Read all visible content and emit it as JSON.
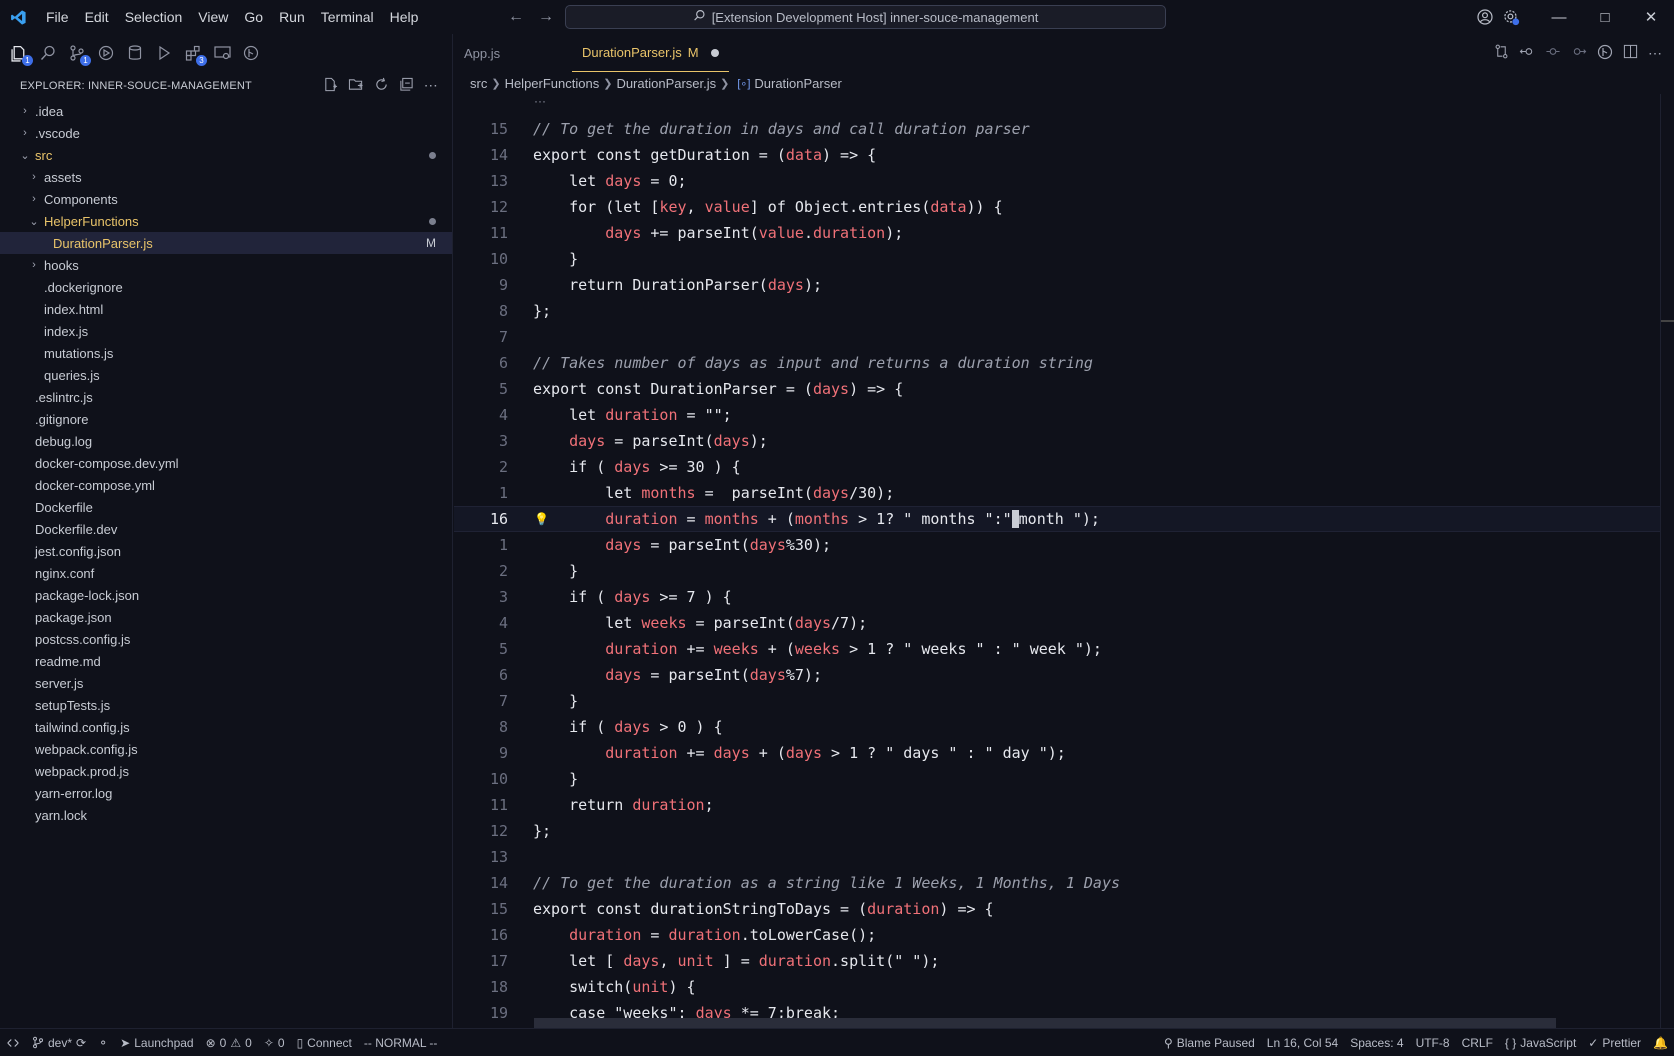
{
  "menu": [
    "File",
    "Edit",
    "Selection",
    "View",
    "Go",
    "Run",
    "Terminal",
    "Help"
  ],
  "command_center": "[Extension Development Host] inner-souce-management",
  "sidebar": {
    "title": "EXPLORER: INNER-SOUCE-MANAGEMENT",
    "badge_explorer": "1",
    "badge_scm": "1",
    "badge_ext": "3",
    "tree": [
      {
        "label": ".idea",
        "depth": 0,
        "chev": "›"
      },
      {
        "label": ".vscode",
        "depth": 0,
        "chev": "›"
      },
      {
        "label": "src",
        "depth": 0,
        "chev": "⌄",
        "dot": true,
        "kind": "src"
      },
      {
        "label": "assets",
        "depth": 1,
        "chev": "›"
      },
      {
        "label": "Components",
        "depth": 1,
        "chev": "›"
      },
      {
        "label": "HelperFunctions",
        "depth": 1,
        "chev": "⌄",
        "dot": true,
        "kind": "open"
      },
      {
        "label": "DurationParser.js",
        "depth": 2,
        "chev": "",
        "mark": "M",
        "kind": "selected"
      },
      {
        "label": "hooks",
        "depth": 1,
        "chev": "›"
      },
      {
        "label": ".dockerignore",
        "depth": 1,
        "chev": ""
      },
      {
        "label": "index.html",
        "depth": 1,
        "chev": ""
      },
      {
        "label": "index.js",
        "depth": 1,
        "chev": ""
      },
      {
        "label": "mutations.js",
        "depth": 1,
        "chev": ""
      },
      {
        "label": "queries.js",
        "depth": 1,
        "chev": ""
      },
      {
        "label": ".eslintrc.js",
        "depth": 0,
        "chev": ""
      },
      {
        "label": ".gitignore",
        "depth": 0,
        "chev": ""
      },
      {
        "label": "debug.log",
        "depth": 0,
        "chev": ""
      },
      {
        "label": "docker-compose.dev.yml",
        "depth": 0,
        "chev": ""
      },
      {
        "label": "docker-compose.yml",
        "depth": 0,
        "chev": ""
      },
      {
        "label": "Dockerfile",
        "depth": 0,
        "chev": ""
      },
      {
        "label": "Dockerfile.dev",
        "depth": 0,
        "chev": ""
      },
      {
        "label": "jest.config.json",
        "depth": 0,
        "chev": ""
      },
      {
        "label": "nginx.conf",
        "depth": 0,
        "chev": ""
      },
      {
        "label": "package-lock.json",
        "depth": 0,
        "chev": ""
      },
      {
        "label": "package.json",
        "depth": 0,
        "chev": ""
      },
      {
        "label": "postcss.config.js",
        "depth": 0,
        "chev": ""
      },
      {
        "label": "readme.md",
        "depth": 0,
        "chev": ""
      },
      {
        "label": "server.js",
        "depth": 0,
        "chev": ""
      },
      {
        "label": "setupTests.js",
        "depth": 0,
        "chev": ""
      },
      {
        "label": "tailwind.config.js",
        "depth": 0,
        "chev": ""
      },
      {
        "label": "webpack.config.js",
        "depth": 0,
        "chev": ""
      },
      {
        "label": "webpack.prod.js",
        "depth": 0,
        "chev": ""
      },
      {
        "label": "yarn-error.log",
        "depth": 0,
        "chev": ""
      },
      {
        "label": "yarn.lock",
        "depth": 0,
        "chev": ""
      }
    ]
  },
  "tabs": [
    {
      "label": "App.js",
      "active": false
    },
    {
      "label": "DurationParser.js",
      "active": true,
      "mark": "M"
    }
  ],
  "breadcrumb": [
    "src",
    "HelperFunctions",
    "DurationParser.js",
    "DurationParser"
  ],
  "code": {
    "fold_hint": "···",
    "lines": [
      {
        "n": "15",
        "html": "<span class=\"cm\">// To get the duration in days and call duration parser</span>"
      },
      {
        "n": "14",
        "html": "export const getDuration = (<span class=\"var\">data</span>) => {"
      },
      {
        "n": "13",
        "html": "    let <span class=\"var\">days</span> = 0;"
      },
      {
        "n": "12",
        "html": "    for (let [<span class=\"var\">key</span>, <span class=\"var\">value</span>] of Object.entries(<span class=\"var\">data</span>)) {"
      },
      {
        "n": "11",
        "html": "        <span class=\"var\">days</span> += parseInt(<span class=\"var\">value</span>.<span class=\"var\">duration</span>);"
      },
      {
        "n": "10",
        "html": "    }"
      },
      {
        "n": "9",
        "html": "    return DurationParser(<span class=\"var\">days</span>);"
      },
      {
        "n": "8",
        "html": "};"
      },
      {
        "n": "7",
        "html": ""
      },
      {
        "n": "6",
        "html": "<span class=\"cm\">// Takes number of days as input and returns a duration string</span>"
      },
      {
        "n": "5",
        "html": "export const DurationParser = (<span class=\"var\">days</span>) => {"
      },
      {
        "n": "4",
        "html": "    let <span class=\"var\">duration</span> = \"\";"
      },
      {
        "n": "3",
        "html": "    <span class=\"var\">days</span> = parseInt(<span class=\"var\">days</span>);"
      },
      {
        "n": "2",
        "html": "    if ( <span class=\"var\">days</span> >= 30 ) {"
      },
      {
        "n": "1",
        "html": "        let <span class=\"var\">months</span> =  parseInt(<span class=\"var\">days</span>/30);"
      },
      {
        "n": "16",
        "current": true,
        "html": "        <span class=\"var\">duration</span> = <span class=\"var\">months</span> + (<span class=\"var\">months</span> > 1? \" months \":\"<span class=\"cursor\"></span>month \");"
      },
      {
        "n": "1",
        "html": "        <span class=\"var\">days</span> = parseInt(<span class=\"var\">days</span>%30);"
      },
      {
        "n": "2",
        "html": "    }"
      },
      {
        "n": "3",
        "html": "    if ( <span class=\"var\">days</span> >= 7 ) {"
      },
      {
        "n": "4",
        "html": "        let <span class=\"var\">weeks</span> = parseInt(<span class=\"var\">days</span>/7);"
      },
      {
        "n": "5",
        "html": "        <span class=\"var\">duration</span> += <span class=\"var\">weeks</span> + (<span class=\"var\">weeks</span> > 1 ? \" weeks \" : \" week \");"
      },
      {
        "n": "6",
        "html": "        <span class=\"var\">days</span> = parseInt(<span class=\"var\">days</span>%7);"
      },
      {
        "n": "7",
        "html": "    }"
      },
      {
        "n": "8",
        "html": "    if ( <span class=\"var\">days</span> > 0 ) {"
      },
      {
        "n": "9",
        "html": "        <span class=\"var\">duration</span> += <span class=\"var\">days</span> + (<span class=\"var\">days</span> > 1 ? \" days \" : \" day \");"
      },
      {
        "n": "10",
        "html": "    }"
      },
      {
        "n": "11",
        "html": "    return <span class=\"var\">duration</span>;"
      },
      {
        "n": "12",
        "html": "};"
      },
      {
        "n": "13",
        "html": ""
      },
      {
        "n": "14",
        "html": "<span class=\"cm\">// To get the duration as a string like 1 Weeks, 1 Months, 1 Days</span>"
      },
      {
        "n": "15",
        "html": "export const durationStringToDays = (<span class=\"var\">duration</span>) => {"
      },
      {
        "n": "16",
        "html": "    <span class=\"var\">duration</span> = <span class=\"var\">duration</span>.toLowerCase();"
      },
      {
        "n": "17",
        "html": "    let [ <span class=\"var\">days</span>, <span class=\"var\">unit</span> ] = <span class=\"var\">duration</span>.split(\" \");"
      },
      {
        "n": "18",
        "html": "    switch(<span class=\"var\">unit</span>) {"
      },
      {
        "n": "19",
        "html": "    case \"weeks\": <span class=\"var\">days</span> *= 7;break;"
      }
    ]
  },
  "status": {
    "branch": "dev*",
    "launchpad": "Launchpad",
    "errors": "0",
    "warnings": "0",
    "ports": "0",
    "connect": "Connect",
    "mode": "-- NORMAL --",
    "blame": "Blame Paused",
    "position": "Ln 16, Col 54",
    "spaces": "Spaces: 4",
    "encoding": "UTF-8",
    "eol": "CRLF",
    "language": "JavaScript",
    "formatter": "Prettier"
  }
}
